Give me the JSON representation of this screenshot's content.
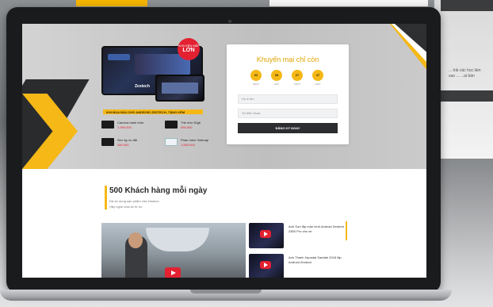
{
  "scene": {
    "yellow": "#f5b816",
    "red": "#e32131",
    "dark": "#1a1b1d"
  },
  "background": {
    "right_text": "... trải các học làm sao ... ...ai bán"
  },
  "hero": {
    "badge": {
      "line1": "KHUYẾN MÃI",
      "line2": "LỚN"
    },
    "product_brand": "Zestech",
    "promo_strip": "KHI MUA ĐẦU DVD ANDROID ZESTECH, TẶNG KÈM",
    "features": [
      {
        "name": "Camera hành trình",
        "price": "1.990.000",
        "icon": "dashcam-icon"
      },
      {
        "name": "Thẻ nhớ 32gb",
        "price": "990.000",
        "icon": "memory-card-icon"
      },
      {
        "name": "Sim 4g ưu đãi",
        "price": "350.000",
        "icon": "sim-card-icon"
      },
      {
        "name": "Phần mềm Vietmap",
        "price": "1.500.000",
        "icon": "map-software-icon"
      }
    ]
  },
  "form": {
    "title": "Khuyến mại chỉ còn",
    "timer": [
      {
        "value": "02",
        "label": "NGÀY"
      },
      {
        "value": "08",
        "label": "GIỜ"
      },
      {
        "value": "27",
        "label": "PHÚT"
      },
      {
        "value": "47",
        "label": "GIÂY"
      }
    ],
    "name_placeholder": "Họ & tên",
    "phone_placeholder": "Số điện thoại",
    "submit_label": "ĐĂNG KÝ NGAY"
  },
  "customers": {
    "title": "500 Khách hàng mỗi ngày",
    "sub1": "Đã sử dụng sản phẩm của Zestech.",
    "sub2": "Hãy nghe chia sẻ từ họ"
  },
  "videos": [
    {
      "title": "Anh Sơn lắp màn hình Android Zestech Z800 Pro cho xe"
    },
    {
      "title": "Anh Thanh Hyundai Santafe 2018 lắp Android Zestech"
    }
  ]
}
